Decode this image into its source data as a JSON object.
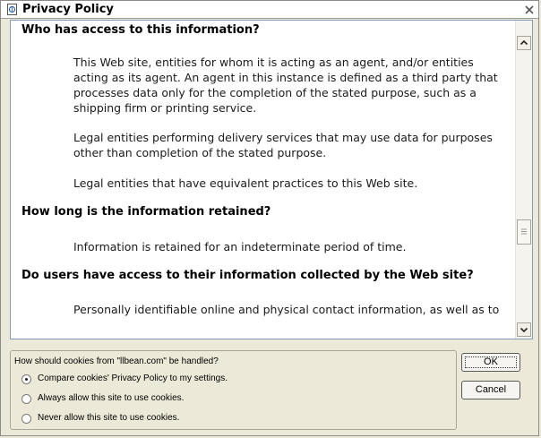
{
  "window": {
    "title": "Privacy Policy"
  },
  "document": {
    "h1": "Who has access to this information?",
    "p1": "This Web site, entities for whom it is acting as an agent, and/or entities acting as its agent. An agent in this instance is defined as a third party that processes data only for the completion of the stated purpose, such as a shipping firm or printing service.",
    "p2": "Legal entities performing delivery services that may use data for purposes other than completion of the stated purpose.",
    "p3": "Legal entities that have equivalent practices to this Web site.",
    "h2": "How long is the information retained?",
    "p4": "Information is retained for an indeterminate period of time.",
    "h3": "Do users have access to their information collected by the Web site?",
    "p5": "Personally identifiable online and physical contact information, as well as to"
  },
  "cookies": {
    "question": "How should cookies from \"llbean.com\" be handled?",
    "options": [
      {
        "label": "Compare cookies' Privacy Policy to my settings.",
        "selected": true
      },
      {
        "label": "Always allow this site to use cookies.",
        "selected": false
      },
      {
        "label": "Never allow this site to use cookies.",
        "selected": false
      }
    ]
  },
  "buttons": {
    "ok": "OK",
    "cancel": "Cancel"
  },
  "icons": {
    "app": "privacy-page-icon",
    "close": "close-icon",
    "scroll_up": "scroll-up-arrow-icon",
    "scroll_down": "scroll-down-arrow-icon"
  }
}
